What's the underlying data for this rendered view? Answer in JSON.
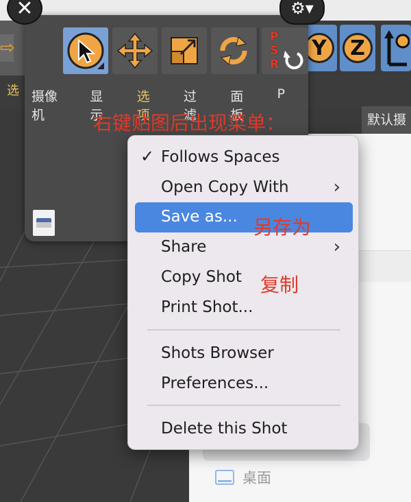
{
  "background": {
    "right_tab_label": "默认摄",
    "left_partial_label": "选",
    "desktop_item_label": "桌面"
  },
  "palette": {
    "menu_labels": [
      "摄像机",
      "显示",
      "选项",
      "过滤",
      "面板",
      "P"
    ],
    "highlighted_menu_label": "选项",
    "tool_icons": [
      "select-arrow-icon",
      "move-icon",
      "scale-icon",
      "rotate-icon",
      "psr-reset-icon"
    ],
    "psr_letters": [
      "P",
      "S",
      "R"
    ]
  },
  "axis_icons": [
    "Y",
    "Z"
  ],
  "annotations": {
    "title": "右键贴图后出现菜单：",
    "save_as_note": "另存为",
    "copy_note": "复制"
  },
  "context_menu": {
    "items": [
      {
        "label": "Follows Spaces",
        "checked": true,
        "submenu": false,
        "selected": false
      },
      {
        "label": "Open Copy With",
        "checked": false,
        "submenu": true,
        "selected": false
      },
      {
        "label": "Save as...",
        "checked": false,
        "submenu": false,
        "selected": true
      },
      {
        "label": "Share",
        "checked": false,
        "submenu": true,
        "selected": false
      },
      {
        "label": "Copy Shot",
        "checked": false,
        "submenu": false,
        "selected": false
      },
      {
        "label": "Print Shot...",
        "checked": false,
        "submenu": false,
        "selected": false
      },
      {
        "label": "Shots Browser",
        "checked": false,
        "submenu": false,
        "selected": false
      },
      {
        "label": "Preferences...",
        "checked": false,
        "submenu": false,
        "selected": false
      },
      {
        "label": "Delete this Shot",
        "checked": false,
        "submenu": false,
        "selected": false
      }
    ],
    "check_glyph": "✓",
    "submenu_glyph": "›",
    "selection_color": "#4a87e0"
  },
  "colors": {
    "annotation_red": "#e03a2a",
    "accent_orange": "#f0a545",
    "active_tool_blue": "#7aa1d6"
  }
}
